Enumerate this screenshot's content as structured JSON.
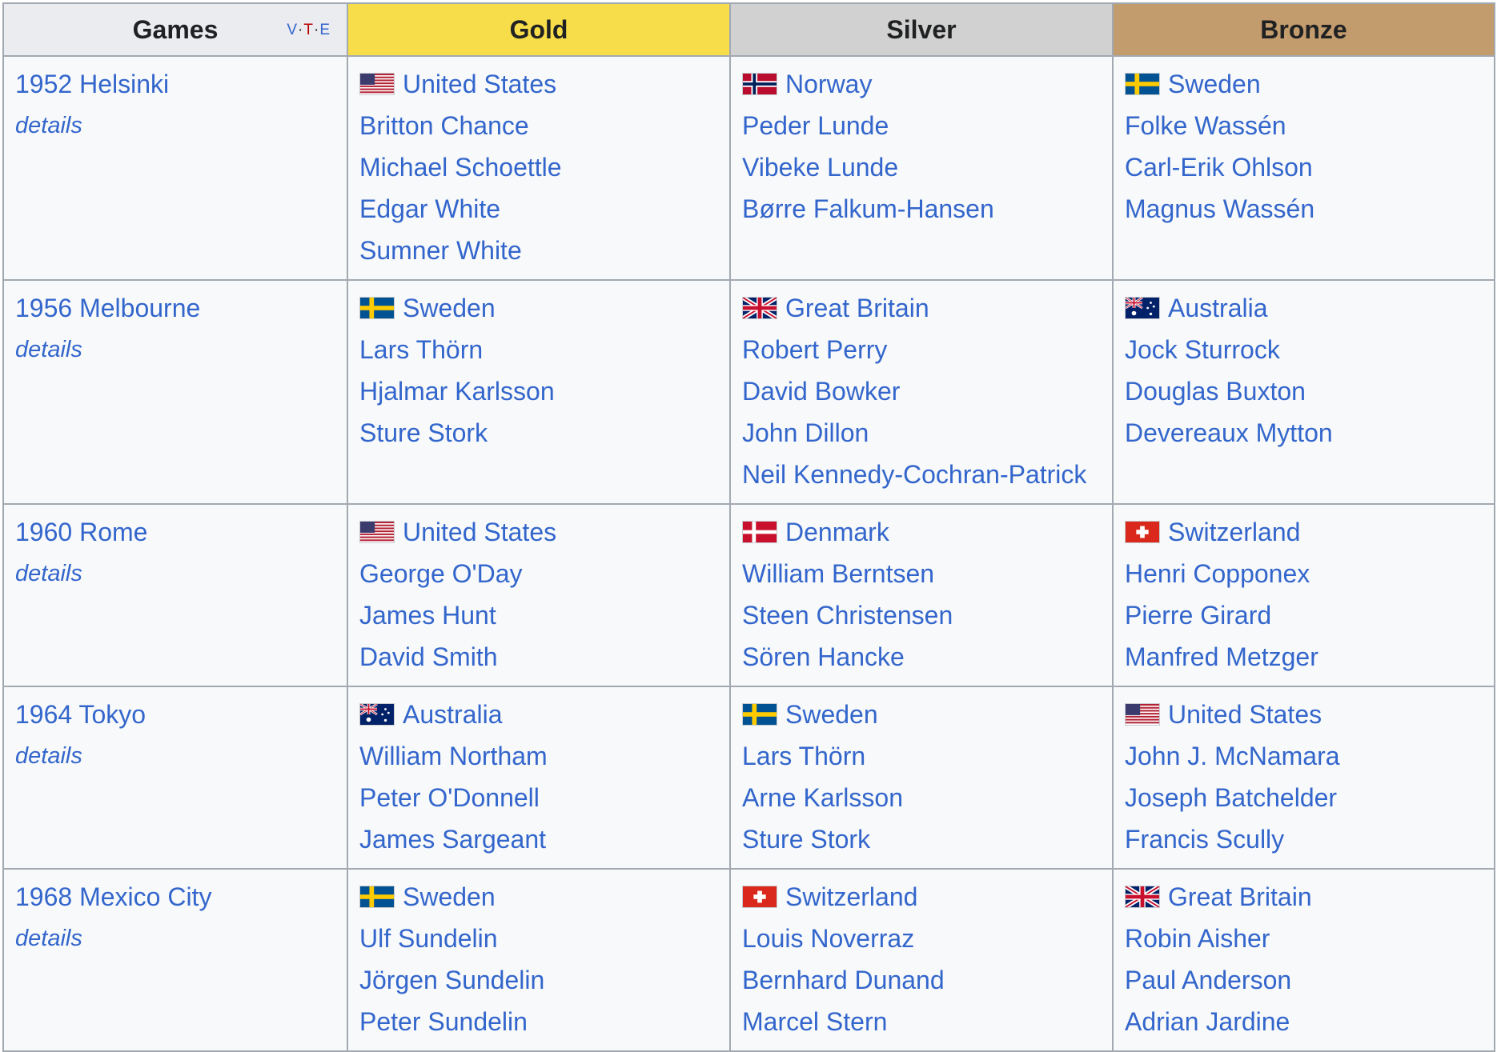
{
  "header": {
    "games": "Games",
    "gold": "Gold",
    "silver": "Silver",
    "bronze": "Bronze",
    "vte": {
      "v": "V",
      "t": "T",
      "e": "E"
    }
  },
  "colors": {
    "gold": "#f7dd4a",
    "silver": "#d1d1d1",
    "bronze": "#c39c6e",
    "link": "#3366cc"
  },
  "rows": [
    {
      "games": "1952 Helsinki",
      "details": "details",
      "gold": {
        "country": "United States",
        "flag": "usa-flag-icon",
        "athletes": [
          "Britton Chance",
          "Michael Schoettle",
          "Edgar White",
          "Sumner White"
        ]
      },
      "silver": {
        "country": "Norway",
        "flag": "norway-flag-icon",
        "athletes": [
          "Peder Lunde",
          "Vibeke Lunde",
          "Børre Falkum-Hansen"
        ]
      },
      "bronze": {
        "country": "Sweden",
        "flag": "sweden-flag-icon",
        "athletes": [
          "Folke Wassén",
          "Carl-Erik Ohlson",
          "Magnus Wassén"
        ]
      }
    },
    {
      "games": "1956 Melbourne",
      "details": "details",
      "gold": {
        "country": "Sweden",
        "flag": "sweden-flag-icon",
        "athletes": [
          "Lars Thörn",
          "Hjalmar Karlsson",
          "Sture Stork"
        ]
      },
      "silver": {
        "country": "Great Britain",
        "flag": "uk-flag-icon",
        "athletes": [
          "Robert Perry",
          "David Bowker",
          "John Dillon",
          "Neil Kennedy-Cochran-Patrick"
        ]
      },
      "bronze": {
        "country": "Australia",
        "flag": "australia-flag-icon",
        "athletes": [
          "Jock Sturrock",
          "Douglas Buxton",
          "Devereaux Mytton"
        ]
      }
    },
    {
      "games": "1960 Rome",
      "details": "details",
      "gold": {
        "country": "United States",
        "flag": "usa-flag-icon",
        "athletes": [
          "George O'Day",
          "James Hunt",
          "David Smith"
        ]
      },
      "silver": {
        "country": "Denmark",
        "flag": "denmark-flag-icon",
        "athletes": [
          "William Berntsen",
          "Steen Christensen",
          "Sören Hancke"
        ]
      },
      "bronze": {
        "country": "Switzerland",
        "flag": "switzerland-flag-icon",
        "athletes": [
          "Henri Copponex",
          "Pierre Girard",
          "Manfred Metzger"
        ]
      }
    },
    {
      "games": "1964 Tokyo",
      "details": "details",
      "gold": {
        "country": "Australia",
        "flag": "australia-flag-icon",
        "athletes": [
          "William Northam",
          "Peter O'Donnell",
          "James Sargeant"
        ]
      },
      "silver": {
        "country": "Sweden",
        "flag": "sweden-flag-icon",
        "athletes": [
          "Lars Thörn",
          "Arne Karlsson",
          "Sture Stork"
        ]
      },
      "bronze": {
        "country": "United States",
        "flag": "usa-flag-icon",
        "athletes": [
          "John J. McNamara",
          "Joseph Batchelder",
          "Francis Scully"
        ]
      }
    },
    {
      "games": "1968 Mexico City",
      "details": "details",
      "gold": {
        "country": "Sweden",
        "flag": "sweden-flag-icon",
        "athletes": [
          "Ulf Sundelin",
          "Jörgen Sundelin",
          "Peter Sundelin"
        ]
      },
      "silver": {
        "country": "Switzerland",
        "flag": "switzerland-flag-icon",
        "athletes": [
          "Louis Noverraz",
          "Bernhard Dunand",
          "Marcel Stern"
        ]
      },
      "bronze": {
        "country": "Great Britain",
        "flag": "uk-flag-icon",
        "athletes": [
          "Robin Aisher",
          "Paul Anderson",
          "Adrian Jardine"
        ]
      }
    }
  ]
}
